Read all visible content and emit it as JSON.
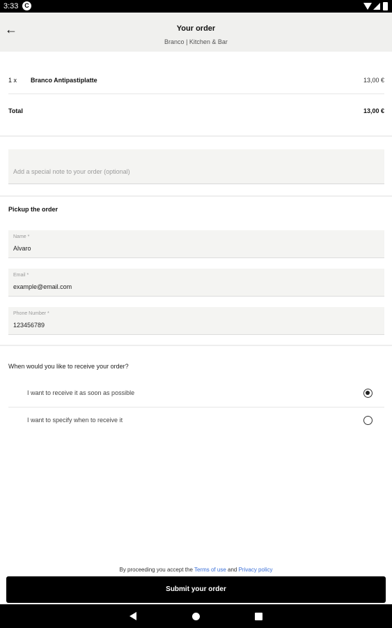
{
  "status_bar": {
    "time": "3:33",
    "app_icon_letter": "C"
  },
  "header": {
    "title": "Your order",
    "subtitle": "Branco | Kitchen & Bar"
  },
  "order": {
    "items": [
      {
        "qty": "1 x",
        "name": "Branco Antipastiplatte",
        "price": "13,00 €"
      }
    ],
    "total_label": "Total",
    "total_value": "13,00 €"
  },
  "note": {
    "placeholder": "Add a special note to your order (optional)"
  },
  "pickup": {
    "title": "Pickup the order",
    "fields": [
      {
        "label": "Name *",
        "value": "Alvaro"
      },
      {
        "label": "Email *",
        "value": "example@email.com"
      },
      {
        "label": "Phone Number *",
        "value": "123456789"
      }
    ]
  },
  "receive": {
    "question": "When would you like to receive your order?",
    "options": [
      {
        "label": "I want to receive it as soon as possible",
        "selected": true
      },
      {
        "label": "I want to specify when to receive it",
        "selected": false
      }
    ]
  },
  "footer": {
    "terms_prefix": "By proceeding you accept the",
    "terms_link": "Terms of use",
    "terms_and": "and",
    "privacy_link": "Privacy policy",
    "submit_label": "Submit your order"
  },
  "icons": {
    "back": "arrow-left-icon",
    "radio_selected": "radio-selected-icon",
    "radio_unselected": "radio-unselected-icon",
    "nav_back": "triangle-back-icon",
    "nav_home": "circle-home-icon",
    "nav_recents": "square-recents-icon"
  },
  "colors": {
    "accent": "#000000",
    "link": "#3a6fd8",
    "header_bg": "#f0f0ee",
    "field_bg": "#f4f4f2"
  }
}
